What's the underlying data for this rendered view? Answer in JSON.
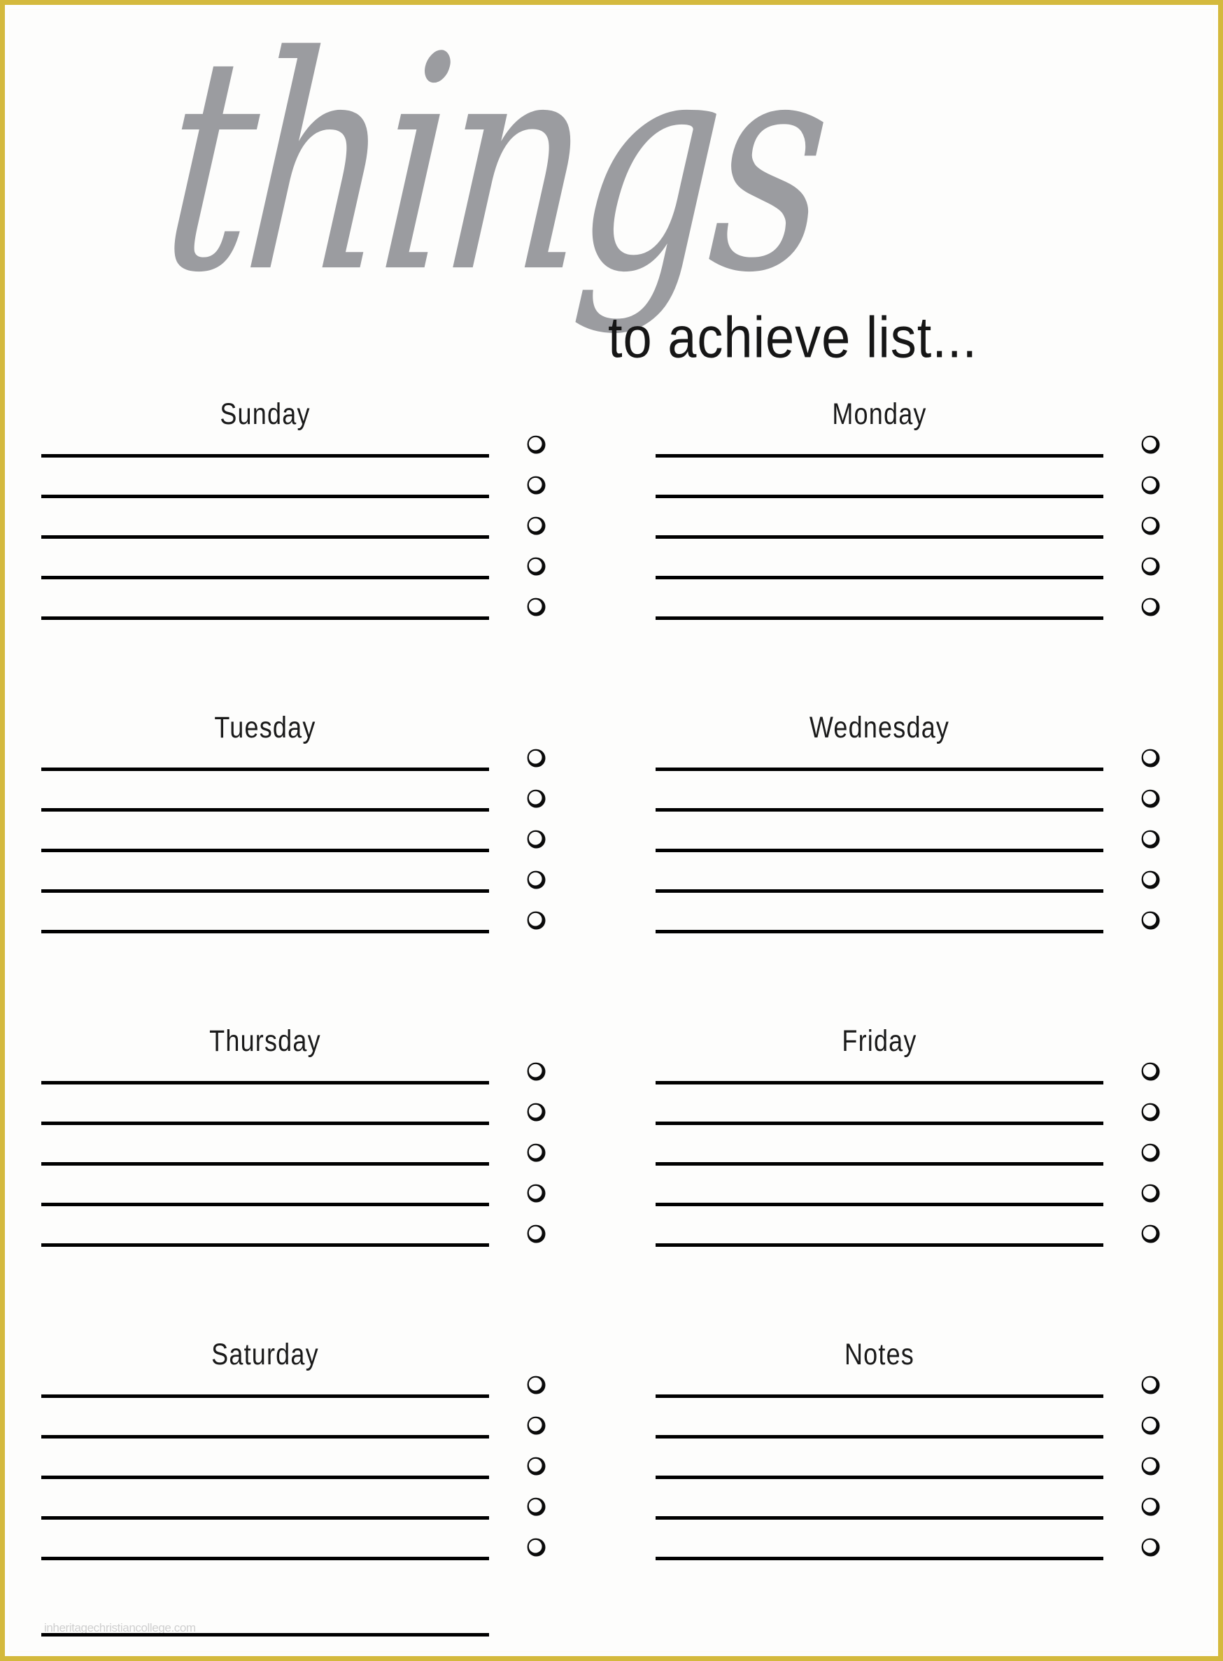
{
  "page": {
    "border_color": "#d4b93c",
    "background": "#fdfdfc"
  },
  "header": {
    "script_word": "things",
    "script_color": "#9b9ca0",
    "subtitle": "to achieve list...",
    "subtitle_color": "#161616"
  },
  "sections": [
    {
      "label": "Sunday",
      "side": "left",
      "line_count": 5,
      "bullet_count": 5,
      "bullet_icon": "hollow-circle-icon"
    },
    {
      "label": "Monday",
      "side": "right",
      "line_count": 5,
      "bullet_count": 5,
      "bullet_icon": "hollow-circle-icon"
    },
    {
      "label": "Tuesday",
      "side": "left",
      "line_count": 5,
      "bullet_count": 5,
      "bullet_icon": "hollow-circle-icon"
    },
    {
      "label": "Wednesday",
      "side": "right",
      "line_count": 5,
      "bullet_count": 5,
      "bullet_icon": "hollow-circle-icon"
    },
    {
      "label": "Thursday",
      "side": "left",
      "line_count": 5,
      "bullet_count": 5,
      "bullet_icon": "hollow-circle-icon"
    },
    {
      "label": "Friday",
      "side": "right",
      "line_count": 5,
      "bullet_count": 5,
      "bullet_icon": "hollow-circle-icon"
    },
    {
      "label": "Saturday",
      "side": "left",
      "line_count": 5,
      "bullet_count": 5,
      "bullet_icon": "hollow-circle-icon"
    },
    {
      "label": "Notes",
      "side": "right",
      "line_count": 5,
      "bullet_count": 5,
      "bullet_icon": "hollow-circle-icon"
    }
  ],
  "footer": {
    "watermark": "inheritagechristiancollege.com"
  }
}
